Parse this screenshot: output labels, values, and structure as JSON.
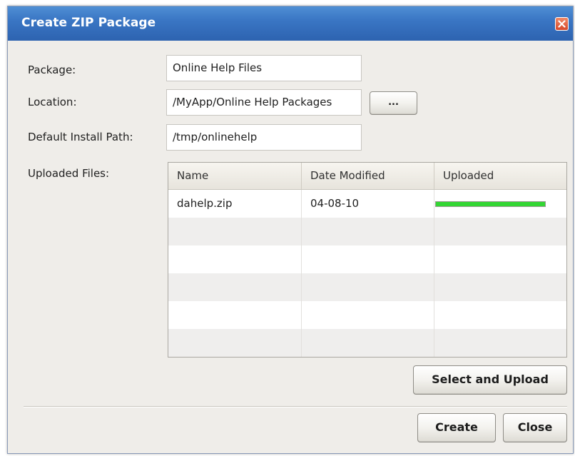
{
  "window": {
    "title": "Create ZIP Package"
  },
  "form": {
    "package_label": "Package:",
    "package_value": "Online Help Files",
    "location_label": "Location:",
    "location_value": "/MyApp/Online Help Packages",
    "browse_label": "...",
    "install_path_label": "Default Install Path:",
    "install_path_value": "/tmp/onlinehelp",
    "uploaded_files_label": "Uploaded Files:"
  },
  "table": {
    "columns": [
      "Name",
      "Date Modified",
      "Uploaded"
    ],
    "rows": [
      {
        "name": "dahelp.zip",
        "date_modified": "04-08-10",
        "uploaded_progress": 1.0
      }
    ]
  },
  "buttons": {
    "select_upload": "Select and Upload",
    "create": "Create",
    "close": "Close"
  },
  "colors": {
    "titlebar": "#3a76c4",
    "progress_fill": "#33d633",
    "close_button": "#d7482a"
  },
  "icons": {
    "close": "close-icon"
  }
}
